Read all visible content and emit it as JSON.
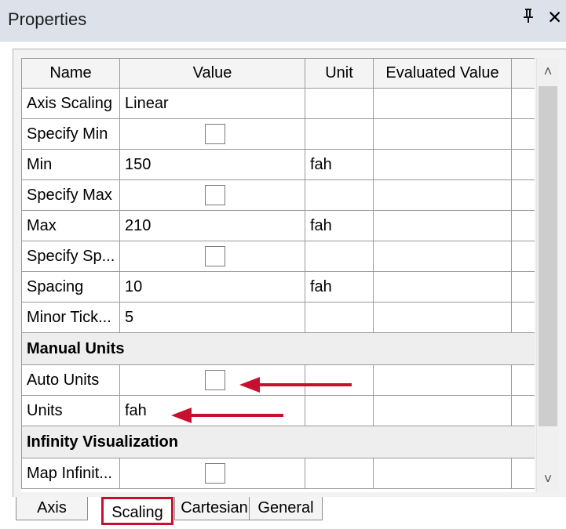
{
  "window": {
    "title": "Properties",
    "pin_glyph": "⌖",
    "close_glyph": "✕"
  },
  "grid": {
    "columns": [
      "Name",
      "Value",
      "Unit",
      "Evaluated Value"
    ],
    "rows": [
      {
        "name": "Axis Scaling",
        "value": "Linear",
        "unit": "",
        "checkbox": false
      },
      {
        "name": "Specify Min",
        "value": "",
        "unit": "",
        "checkbox": true,
        "checked": false
      },
      {
        "name": "Min",
        "value": "150",
        "unit": "fah",
        "checkbox": false
      },
      {
        "name": "Specify Max",
        "value": "",
        "unit": "",
        "checkbox": true,
        "checked": false
      },
      {
        "name": "Max",
        "value": "210",
        "unit": "fah",
        "checkbox": false
      },
      {
        "name": "Specify Sp...",
        "value": "",
        "unit": "",
        "checkbox": true,
        "checked": false
      },
      {
        "name": "Spacing",
        "value": "10",
        "unit": "fah",
        "checkbox": false
      },
      {
        "name": "Minor Tick...",
        "value": "5",
        "unit": "",
        "checkbox": false
      }
    ],
    "group_manual_units": "Manual Units",
    "manual_rows": [
      {
        "name": "Auto Units",
        "value": "",
        "unit": "",
        "checkbox": true,
        "checked": false
      },
      {
        "name": "Units",
        "value": "fah",
        "unit": "",
        "checkbox": false
      }
    ],
    "group_infinity": "Infinity Visualization",
    "infinity_rows": [
      {
        "name": "Map Infinit...",
        "value": "",
        "unit": "",
        "checkbox": true,
        "checked": false
      }
    ]
  },
  "annotations": {
    "arrow_color": "#c8102e"
  },
  "scrollbar": {
    "up_glyph": "˄",
    "down_glyph": "˅"
  },
  "tabs": [
    {
      "label": "Axis",
      "active": false
    },
    {
      "label": "Scaling",
      "active": true
    },
    {
      "label": "Cartesian",
      "active": false
    },
    {
      "label": "General",
      "active": false
    }
  ],
  "colors": {
    "highlight": "#c8102e",
    "titlebar": "#dde2ea"
  }
}
